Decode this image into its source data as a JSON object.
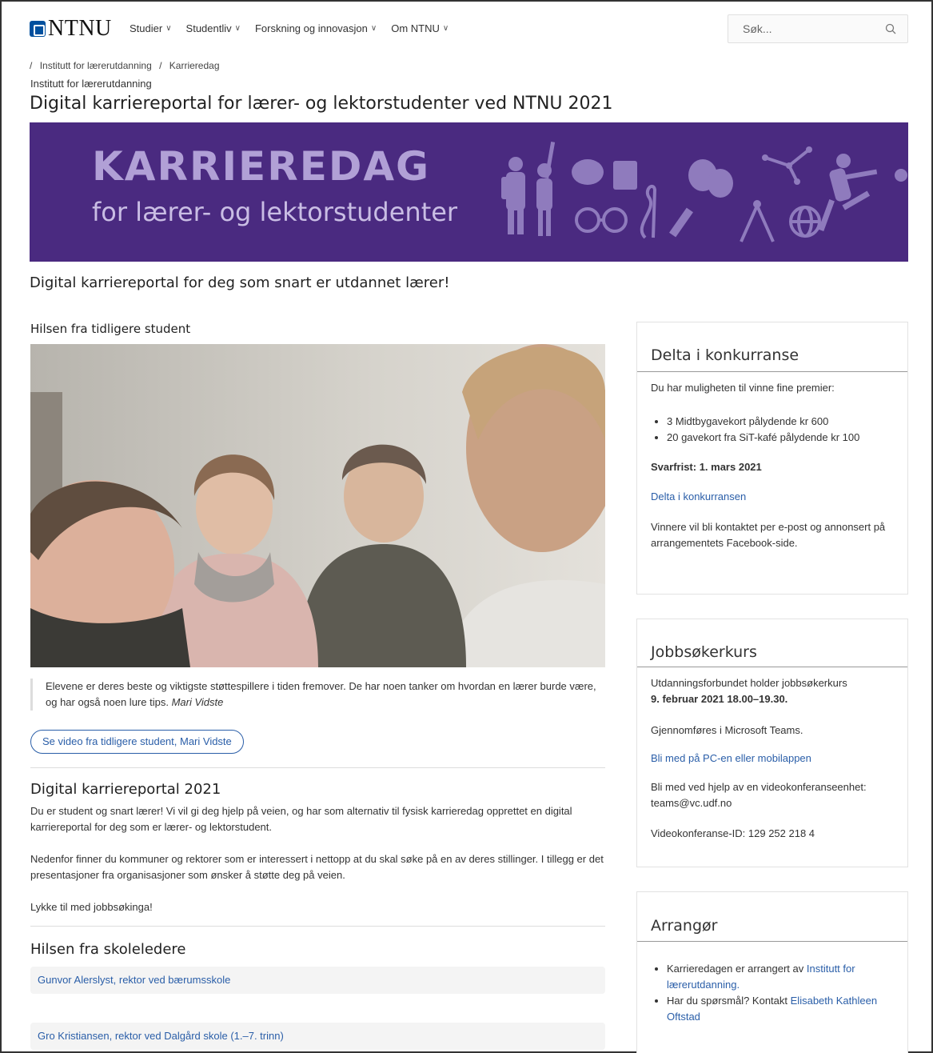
{
  "header": {
    "logo_text": "NTNU",
    "nav": [
      {
        "label": "Studier"
      },
      {
        "label": "Studentliv"
      },
      {
        "label": "Forskning og innovasjon"
      },
      {
        "label": "Om NTNU"
      }
    ],
    "search_placeholder": "Søk..."
  },
  "breadcrumb": {
    "sep": "/",
    "items": [
      "Institutt for lærerutdanning",
      "Karrieredag"
    ]
  },
  "page": {
    "supertitle": "Institutt for lærerutdanning",
    "title": "Digital karriereportal for lærer- og lektorstudenter ved NTNU 2021",
    "lead": "Digital karriereportal for deg som snart er utdannet lærer!"
  },
  "banner": {
    "big": "KARRIEREDAG",
    "small": "for lærer- og lektorstudenter",
    "bg_color": "#4a2a80"
  },
  "greeting": {
    "title": "Hilsen fra tidligere student",
    "quote": "Elevene er deres beste og viktigste støttespillere i tiden fremover. De har noen tanker om hvordan en lærer burde være, og har også noen lure tips.",
    "quote_author": "Mari Vidste",
    "video_button": "Se video fra tidligere student, Mari Vidste"
  },
  "portal": {
    "title": "Digital karriereportal 2021",
    "p1": "Du er student og snart lærer! Vi vil gi deg hjelp på veien, og har som alternativ til fysisk karrieredag opprettet en digital karriereportal for deg som er lærer- og lektorstudent.",
    "p2": "Nedenfor finner du kommuner og rektorer som er interessert i nettopp at du skal søke på en av deres stillinger. I tillegg er det presentasjoner fra organisasjoner som ønsker å støtte deg på veien.",
    "p3": "Lykke til med jobbsøkinga!"
  },
  "leaders": {
    "title": "Hilsen fra skoleledere",
    "items": [
      "Gunvor Alerslyst, rektor ved bærumsskole",
      "Gro Kristiansen, rektor ved Dalgård skole (1.–7. trinn)"
    ]
  },
  "sidebar": {
    "contest": {
      "title": "Delta i konkurranse",
      "intro": "Du har muligheten til vinne fine premier:",
      "prizes": [
        "3 Midtbygavekort pålydende kr 600",
        "20 gavekort fra SiT-kafé pålydende kr 100"
      ],
      "deadline": "Svarfrist: 1. mars 2021",
      "link": "Delta i konkurransen",
      "note": "Vinnere vil bli kontaktet per e-post og annonsert på arrangementets Facebook-side."
    },
    "course": {
      "title": "Jobbsøkerkurs",
      "line1": "Utdanningsforbundet holder jobbsøkerkurs",
      "date": "9. februar 2021 18.00–19.30.",
      "teams": "Gjennomføres i Microsoft Teams.",
      "link": "Bli med på PC-en eller mobilappen",
      "video": "Bli med ved hjelp av en videokonferanseenhet: teams@vc.udf.no",
      "conf_id": "Videokonferanse-ID: 129 252 218 4"
    },
    "organizer": {
      "title": "Arrangør",
      "item1_text": "Karrieredagen er arrangert av",
      "item1_link": "Institutt for lærerutdanning.",
      "item2_text": "Har du spørsmål? Kontakt",
      "item2_link": "Elisabeth Kathleen Oftstad"
    }
  },
  "colors": {
    "link": "#2a5ea8",
    "brand": "#00509e"
  }
}
